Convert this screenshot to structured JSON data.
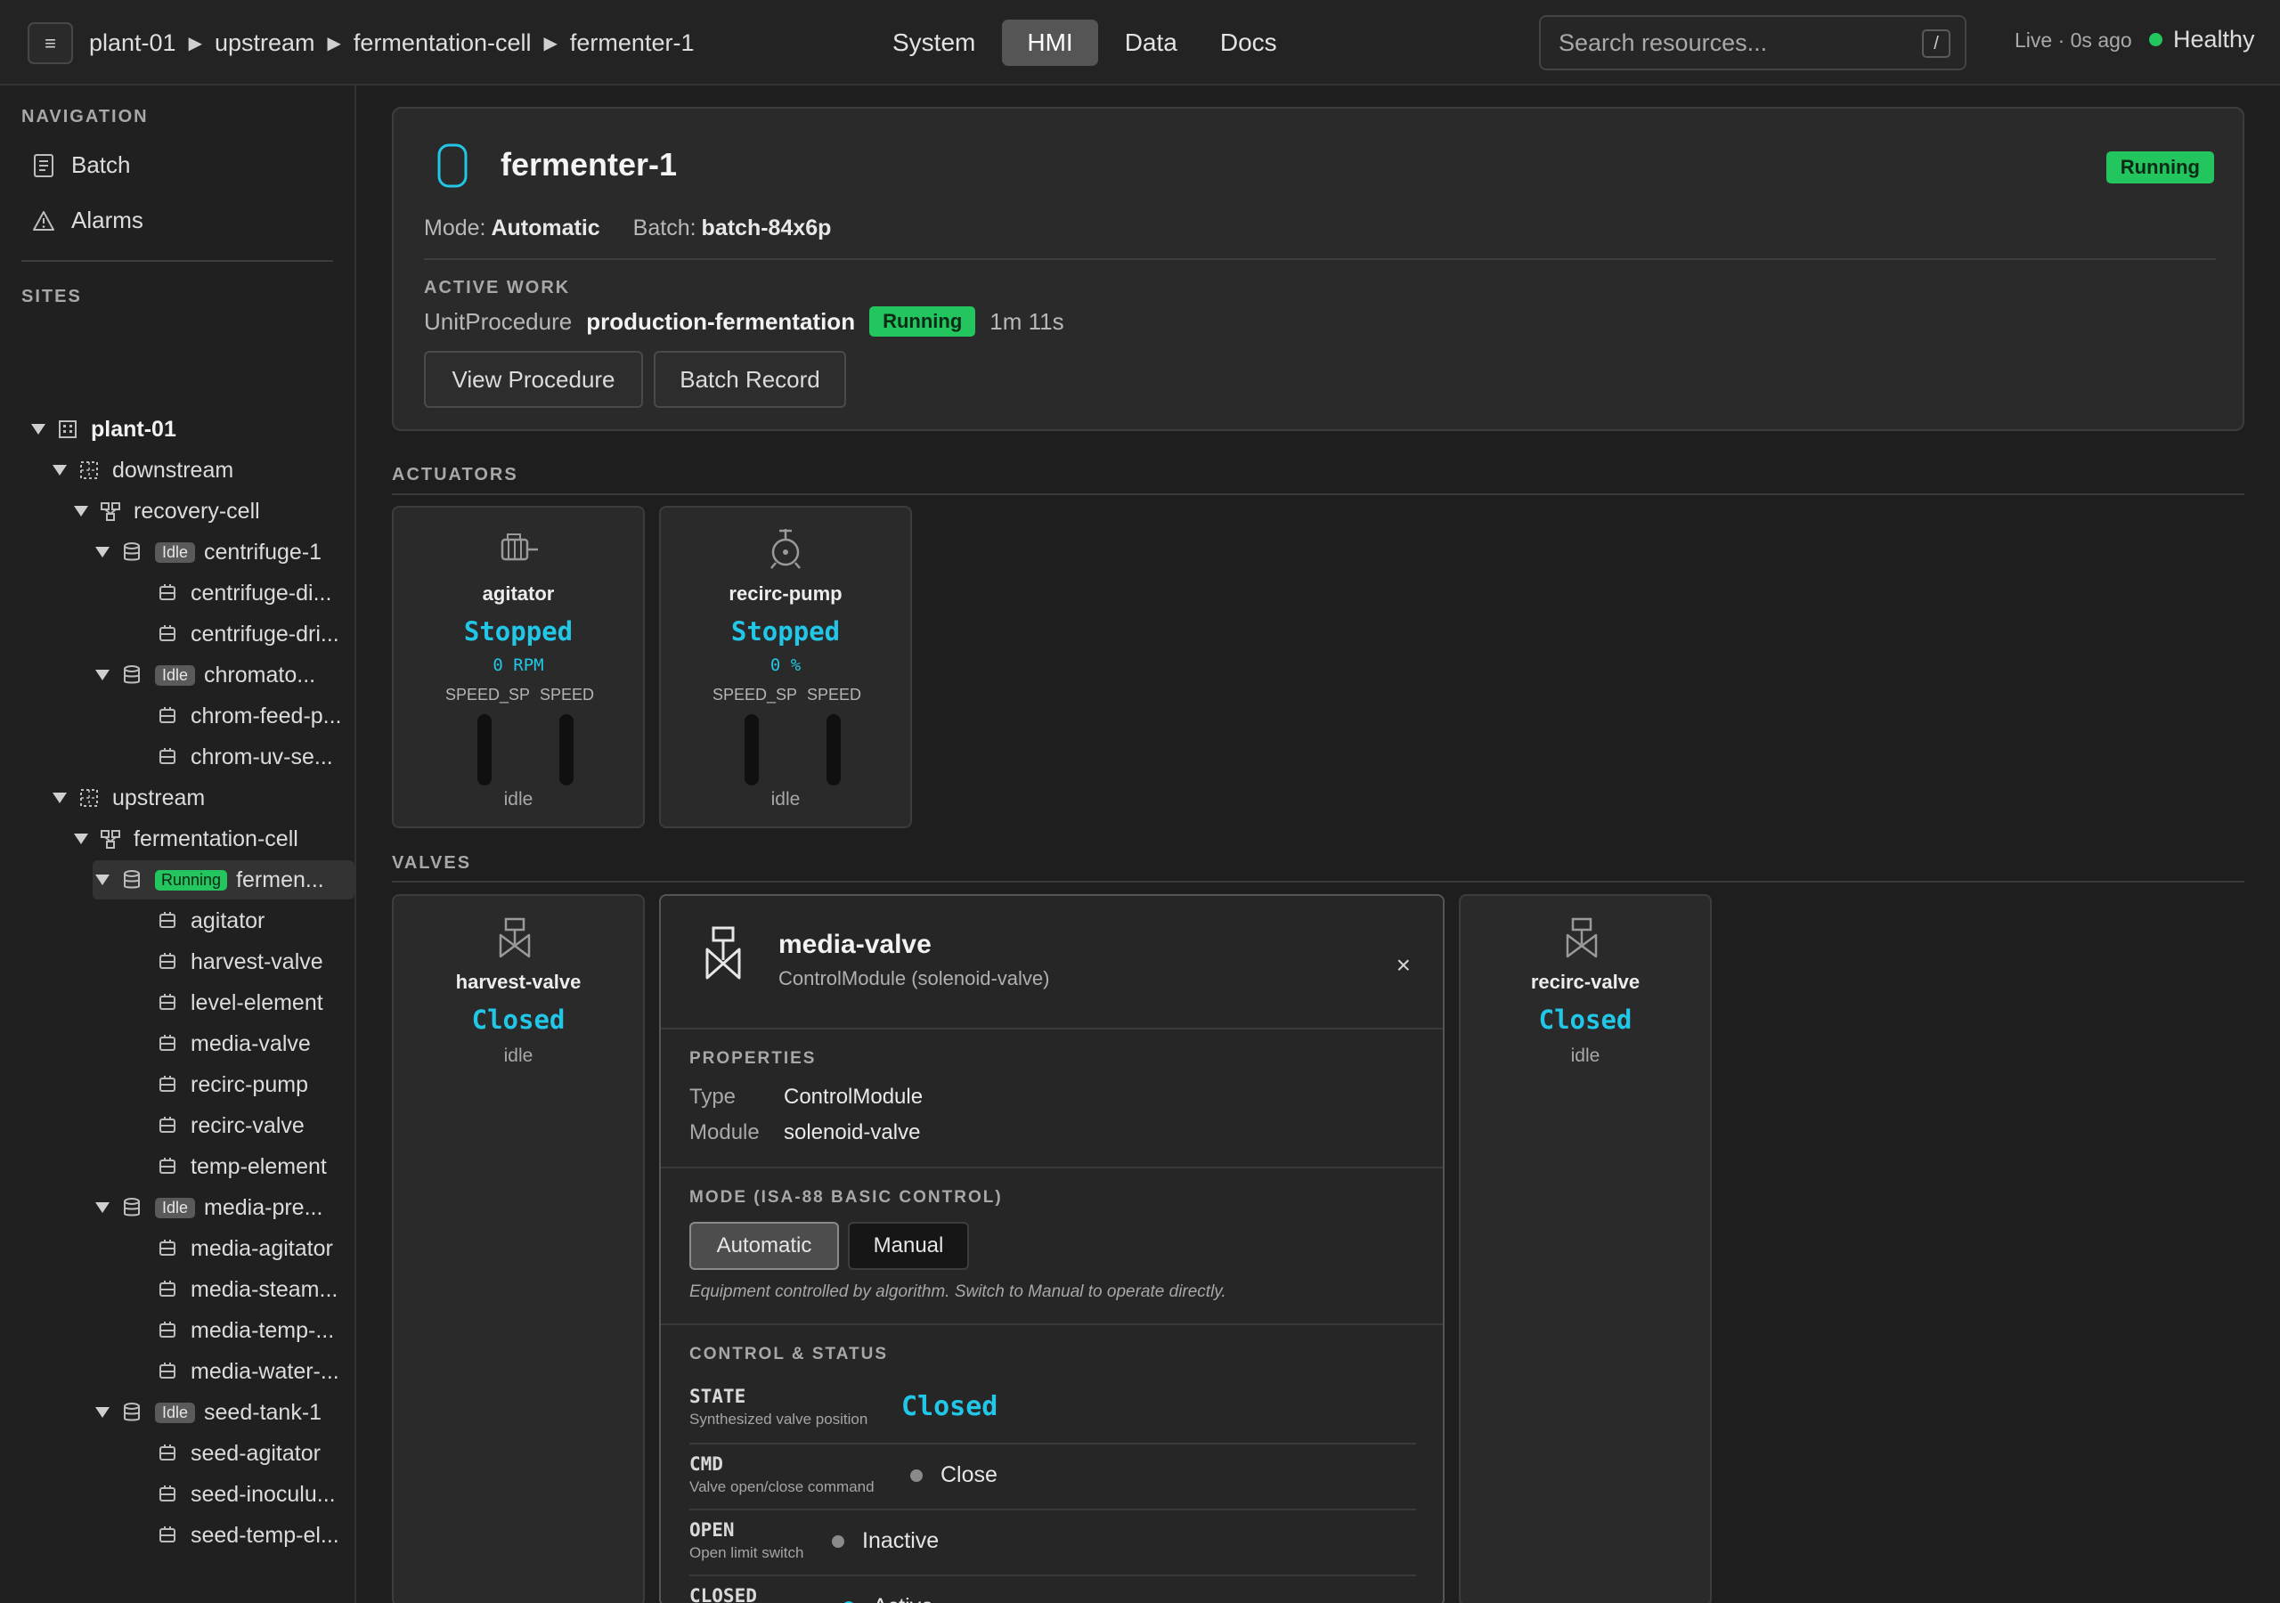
{
  "topbar": {
    "menu_icon": "≡",
    "breadcrumb": [
      "plant-01",
      "upstream",
      "fermentation-cell",
      "fermenter-1"
    ],
    "breadcrumb_separator": "▶",
    "tabs": [
      "System",
      "HMI",
      "Data",
      "Docs"
    ],
    "active_tab": "HMI",
    "search_placeholder": "Search resources...",
    "search_shortcut": "/",
    "live_status": "Live · 0s ago",
    "health": "Healthy",
    "health_color": "#22c55e"
  },
  "sidebar": {
    "navigation_title": "NAVIGATION",
    "nav_items": [
      {
        "label": "Batch",
        "icon": "batch-document-icon"
      },
      {
        "label": "Alarms",
        "icon": "alarm-triangle-icon"
      }
    ],
    "sites_title": "SITES",
    "tree": [
      {
        "label": "plant-01",
        "icon": "site-icon",
        "expanded": true,
        "bold": true
      },
      {
        "label": "downstream",
        "icon": "area-icon",
        "expanded": true
      },
      {
        "label": "recovery-cell",
        "icon": "cell-icon",
        "expanded": true
      },
      {
        "label": "centrifuge-1",
        "icon": "unit-icon",
        "badge": "Idle",
        "expanded": true
      },
      {
        "label": "centrifuge-di...",
        "icon": "module-icon"
      },
      {
        "label": "centrifuge-dri...",
        "icon": "module-icon"
      },
      {
        "label": "chromato...",
        "icon": "unit-icon",
        "badge": "Idle",
        "expanded": true
      },
      {
        "label": "chrom-feed-p...",
        "icon": "module-icon"
      },
      {
        "label": "chrom-uv-se...",
        "icon": "module-icon"
      },
      {
        "label": "upstream",
        "icon": "area-icon",
        "expanded": true
      },
      {
        "label": "fermentation-cell",
        "icon": "cell-icon",
        "expanded": true
      },
      {
        "label": "fermen...",
        "icon": "unit-icon",
        "badge": "Running",
        "expanded": true,
        "selected": true
      },
      {
        "label": "agitator",
        "icon": "module-icon"
      },
      {
        "label": "harvest-valve",
        "icon": "module-icon"
      },
      {
        "label": "level-element",
        "icon": "module-icon"
      },
      {
        "label": "media-valve",
        "icon": "module-icon"
      },
      {
        "label": "recirc-pump",
        "icon": "module-icon"
      },
      {
        "label": "recirc-valve",
        "icon": "module-icon"
      },
      {
        "label": "temp-element",
        "icon": "module-icon"
      },
      {
        "label": "media-pre...",
        "icon": "unit-icon",
        "badge": "Idle",
        "expanded": true
      },
      {
        "label": "media-agitator",
        "icon": "module-icon"
      },
      {
        "label": "media-steam...",
        "icon": "module-icon"
      },
      {
        "label": "media-temp-...",
        "icon": "module-icon"
      },
      {
        "label": "media-water-...",
        "icon": "module-icon"
      },
      {
        "label": "seed-tank-1",
        "icon": "unit-icon",
        "badge": "Idle",
        "expanded": true
      },
      {
        "label": "seed-agitator",
        "icon": "module-icon"
      },
      {
        "label": "seed-inoculu...",
        "icon": "module-icon"
      },
      {
        "label": "seed-temp-el...",
        "icon": "module-icon"
      }
    ]
  },
  "unit": {
    "name": "fermenter-1",
    "status": "Running",
    "mode_label": "Mode:",
    "mode": "Automatic",
    "batch_label": "Batch:",
    "batch": "batch-84x6p",
    "active_work_title": "ACTIVE WORK",
    "procedure_type": "UnitProcedure",
    "procedure_name": "production-fermentation",
    "procedure_status": "Running",
    "elapsed": "1m 11s",
    "view_procedure": "View Procedure",
    "batch_record": "Batch Record"
  },
  "actuators": {
    "title": "ACTUATORS",
    "items": [
      {
        "name": "agitator",
        "state": "Stopped",
        "value": "0 RPM",
        "sp_label": "SPEED_SP",
        "pv_label": "SPEED",
        "sp": 0,
        "pv": 0,
        "status": "idle",
        "icon": "motor-icon"
      },
      {
        "name": "recirc-pump",
        "state": "Stopped",
        "value": "0 %",
        "sp_label": "SPEED_SP",
        "pv_label": "SPEED",
        "sp": 0,
        "pv": 0,
        "status": "idle",
        "icon": "pump-icon"
      }
    ]
  },
  "valves": {
    "title": "VALVES",
    "items": [
      {
        "name": "harvest-valve",
        "state": "Closed",
        "status": "idle",
        "icon": "valve-icon"
      },
      {
        "name": "recirc-valve",
        "state": "Closed",
        "status": "idle",
        "icon": "valve-icon"
      }
    ]
  },
  "detail": {
    "name": "media-valve",
    "subtitle": "ControlModule (solenoid-valve)",
    "close": "×",
    "properties_title": "PROPERTIES",
    "type_label": "Type",
    "type": "ControlModule",
    "module_label": "Module",
    "module": "solenoid-valve",
    "mode_title": "MODE (ISA-88 BASIC CONTROL)",
    "mode_auto": "Automatic",
    "mode_manual": "Manual",
    "mode_note": "Equipment controlled by algorithm. Switch to Manual to operate directly.",
    "control_title": "CONTROL & STATUS",
    "signals": [
      {
        "key": "STATE",
        "desc": "Synthesized valve position",
        "value": "Closed"
      },
      {
        "key": "CMD",
        "desc": "Valve open/close command",
        "value": "Close"
      },
      {
        "key": "OPEN",
        "desc": "Open limit switch",
        "value": "Inactive"
      },
      {
        "key": "CLOSED",
        "desc": "",
        "value": "Active"
      }
    ]
  },
  "colors": {
    "accent_cyan": "#22c6e6",
    "running_green": "#22c55e",
    "idle_gray": "#5a5a5a"
  }
}
